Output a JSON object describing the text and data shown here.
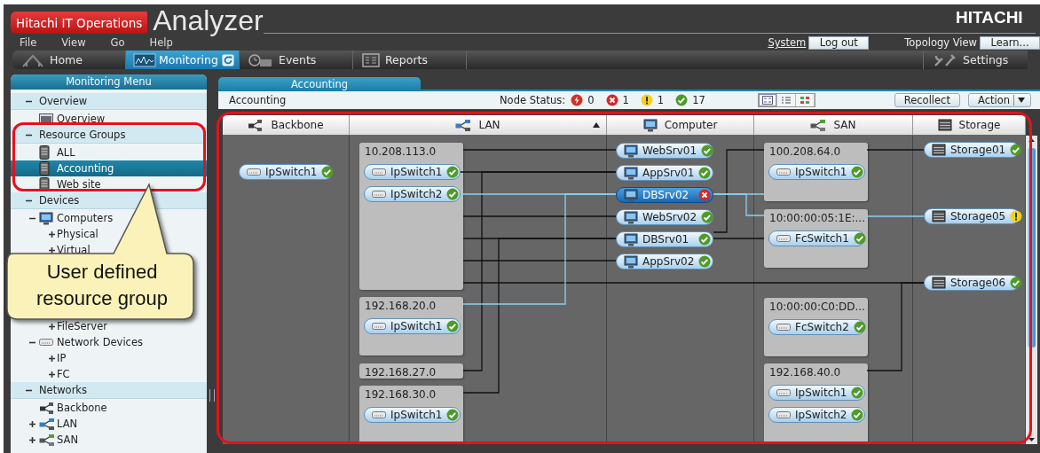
{
  "header": {
    "brand_badge": "Hitachi IT Operations",
    "product": "Analyzer",
    "company": "HITACHI"
  },
  "menu": [
    "File",
    "View",
    "Go",
    "Help"
  ],
  "account": {
    "system_link": "System",
    "logout": "Log out",
    "view_name": "Topology View",
    "learn": "Learn..."
  },
  "nav_tabs": [
    {
      "label": "Home",
      "kind": "home",
      "selected": false
    },
    {
      "label": "Monitoring",
      "kind": "monitoring",
      "selected": true
    },
    {
      "label": "Events",
      "kind": "events",
      "selected": false
    },
    {
      "label": "Reports",
      "kind": "reports",
      "selected": false
    }
  ],
  "settings": "Settings",
  "sidebar": {
    "title": "Monitoring Menu",
    "sections": [
      {
        "label": "Overview",
        "expanded": true,
        "items": [
          {
            "label": "Overview",
            "kind": "report",
            "selected": false
          }
        ]
      },
      {
        "label": "Resource Groups",
        "expanded": true,
        "items": [
          {
            "label": "ALL",
            "kind": "rack",
            "selected": false
          },
          {
            "label": "Accounting",
            "kind": "rack",
            "selected": true
          },
          {
            "label": "Web site",
            "kind": "rack",
            "selected": false
          }
        ]
      },
      {
        "label": "Devices",
        "expanded": true,
        "items": [
          {
            "label": "Computers",
            "kind": "computer",
            "selected": false,
            "expanded": true,
            "children": [
              {
                "label": "Physical",
                "expanded": false
              },
              {
                "label": "Virtual",
                "expanded": false
              },
              {
                "label": "FileServer",
                "expanded": false
              }
            ]
          },
          {
            "label": "Network Devices",
            "kind": "switch",
            "selected": false,
            "expanded": true,
            "children": [
              {
                "label": "IP",
                "expanded": false
              },
              {
                "label": "FC",
                "expanded": false
              }
            ]
          }
        ]
      },
      {
        "label": "Networks",
        "expanded": true,
        "items": [
          {
            "label": "Backbone",
            "kind": "backbone",
            "selected": false
          },
          {
            "label": "LAN",
            "kind": "lan",
            "selected": false,
            "expanded": false
          },
          {
            "label": "SAN",
            "kind": "san",
            "selected": false,
            "expanded": false
          }
        ]
      }
    ]
  },
  "callout": {
    "text": "User defined resource group"
  },
  "view_tab": {
    "label": "Accounting",
    "selected": true
  },
  "toolbar": {
    "group_name": "Accounting",
    "status_label": "Node Status:",
    "status_counts": [
      {
        "kind": "critical",
        "count": "0"
      },
      {
        "kind": "error",
        "count": "1"
      },
      {
        "kind": "warning",
        "count": "1"
      },
      {
        "kind": "ok",
        "count": "17"
      }
    ],
    "view_modes": [
      {
        "kind": "topology",
        "selected": true
      },
      {
        "kind": "list",
        "selected": false
      },
      {
        "kind": "matrix",
        "selected": false
      }
    ],
    "buttons": [
      "Recollect",
      "Action"
    ]
  },
  "topology": {
    "columns": [
      {
        "title": "Backbone",
        "kind": "backbone",
        "sorted": false,
        "nodes": [
          {
            "name": "IpSwitch1",
            "error": false,
            "warning": false,
            "selected": false
          }
        ]
      },
      {
        "title": "LAN",
        "kind": "lan",
        "sorted": true,
        "groups": [
          {
            "label": "10.208.113.0",
            "nodes": [
              {
                "name": "IpSwitch1",
                "error": false,
                "warning": false,
                "selected": false
              },
              {
                "name": "IpSwitch2",
                "error": false,
                "warning": false,
                "selected": false
              }
            ]
          },
          {
            "label": "192.168.20.0",
            "nodes": [
              {
                "name": "IpSwitch1",
                "error": false,
                "warning": false,
                "selected": false
              }
            ]
          },
          {
            "label": "192.168.27.0"
          },
          {
            "label": "192.168.30.0",
            "nodes": [
              {
                "name": "IpSwitch1",
                "error": false,
                "warning": false,
                "selected": false
              }
            ]
          }
        ]
      },
      {
        "title": "Computer",
        "kind": "computer",
        "sorted": false,
        "nodes": [
          {
            "name": "WebSrv01",
            "error": false,
            "warning": false,
            "selected": false
          },
          {
            "name": "AppSrv01",
            "error": false,
            "warning": false,
            "selected": false
          },
          {
            "name": "DBSrv02",
            "error": true,
            "warning": false,
            "selected": true
          },
          {
            "name": "WebSrv02",
            "error": false,
            "warning": false,
            "selected": false
          },
          {
            "name": "DBSrv01",
            "error": false,
            "warning": false,
            "selected": false
          },
          {
            "name": "AppSrv02",
            "error": false,
            "warning": false,
            "selected": false
          }
        ]
      },
      {
        "title": "SAN",
        "kind": "san",
        "sorted": false,
        "groups": [
          {
            "label": "100.208.64.0",
            "nodes": [
              {
                "name": "IpSwitch1",
                "error": false,
                "warning": false,
                "selected": false
              }
            ]
          },
          {
            "label": "10:00:00:05:1E:...",
            "nodes": [
              {
                "name": "FcSwitch1",
                "error": false,
                "warning": false,
                "selected": false
              }
            ]
          },
          {
            "label": "10:00:00:C0:DD...",
            "nodes": [
              {
                "name": "FcSwitch2",
                "error": false,
                "warning": false,
                "selected": false
              }
            ]
          },
          {
            "label": "192.168.40.0",
            "nodes": [
              {
                "name": "IpSwitch1",
                "error": false,
                "warning": false,
                "selected": false
              },
              {
                "name": "IpSwitch2",
                "error": false,
                "warning": false,
                "selected": false
              }
            ]
          }
        ]
      },
      {
        "title": "Storage",
        "kind": "storage",
        "sorted": false,
        "nodes": [
          {
            "name": "Storage01",
            "error": false,
            "warning": false,
            "selected": false
          },
          {
            "name": "Storage05",
            "error": false,
            "warning": true,
            "selected": false
          },
          {
            "name": "Storage06",
            "error": false,
            "warning": false,
            "selected": false
          }
        ]
      }
    ]
  }
}
